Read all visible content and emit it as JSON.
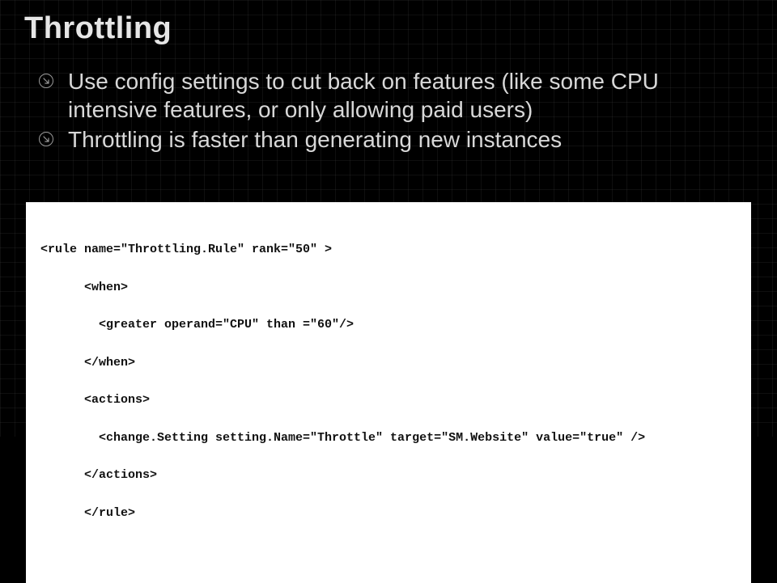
{
  "title": "Throttling",
  "bullets": [
    "Use config settings to cut back on features (like some CPU intensive features, or only allowing paid users)",
    "Throttling is faster than generating new instances"
  ],
  "code": {
    "l1": "<rule name=\"Throttling.Rule\" rank=\"50\" >",
    "l2": "<when>",
    "l3": "<greater operand=\"CPU\" than =\"60\"/>",
    "l4": "</when>",
    "l5": "<actions>",
    "l6": "<change.Setting setting.Name=\"Throttle\" target=\"SM.Website\" value=\"true\" />",
    "l7": "</actions>",
    "l8": "</rule>"
  }
}
